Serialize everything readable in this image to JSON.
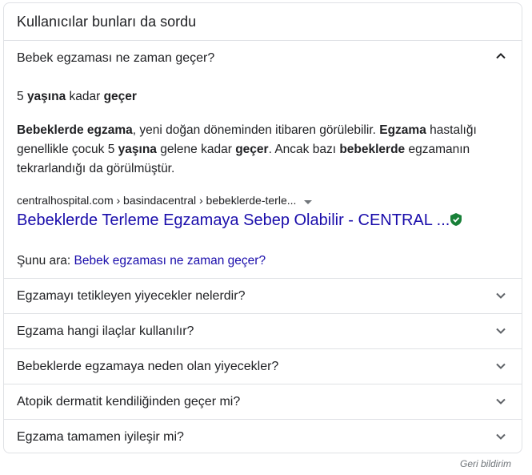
{
  "header": {
    "title": "Kullanıcılar bunları da sordu"
  },
  "expanded": {
    "question": "Bebek egzaması ne zaman geçer?",
    "short_answer": {
      "p1": "5 ",
      "b1": "yaşına",
      "p2": " kadar ",
      "b2": "geçer"
    },
    "paragraph": {
      "b1": "Bebeklerde egzama",
      "t1": ", yeni doğan döneminden itibaren görülebilir. ",
      "b2": "Egzama",
      "t2": " hastalığı genellikle çocuk 5 ",
      "b3": "yaşına",
      "t3": " gelene kadar ",
      "b4": "geçer",
      "t4": ". Ancak bazı ",
      "b5": "bebeklerde",
      "t5": " egzamanın tekrarlandığı da görülmüştür."
    },
    "source_breadcrumb": "centralhospital.com › basindacentral › bebeklerde-terle...",
    "result_title": "Bebeklerde Terleme Egzamaya Sebep Olabilir - CENTRAL ...",
    "search_for_label": "Şunu ara: ",
    "search_for_query": "Bebek egzaması ne zaman geçer?"
  },
  "questions": [
    {
      "text": "Egzamayı tetikleyen yiyecekler nelerdir?"
    },
    {
      "text": "Egzama hangi ilaçlar kullanılır?"
    },
    {
      "text": "Bebeklerde egzamaya neden olan yiyecekler?"
    },
    {
      "text": "Atopik dermatit kendiliğinden geçer mi?"
    },
    {
      "text": "Egzama tamamen iyileşir mi?"
    }
  ],
  "footer": {
    "feedback": "Geri bildirim"
  },
  "colors": {
    "link": "#1a0dab",
    "border": "#dfe1e5",
    "verified": "#188038"
  },
  "icons": {
    "expanded": "chevron-up-icon",
    "collapsed": "chevron-down-icon",
    "verified": "verified-shield-icon"
  }
}
